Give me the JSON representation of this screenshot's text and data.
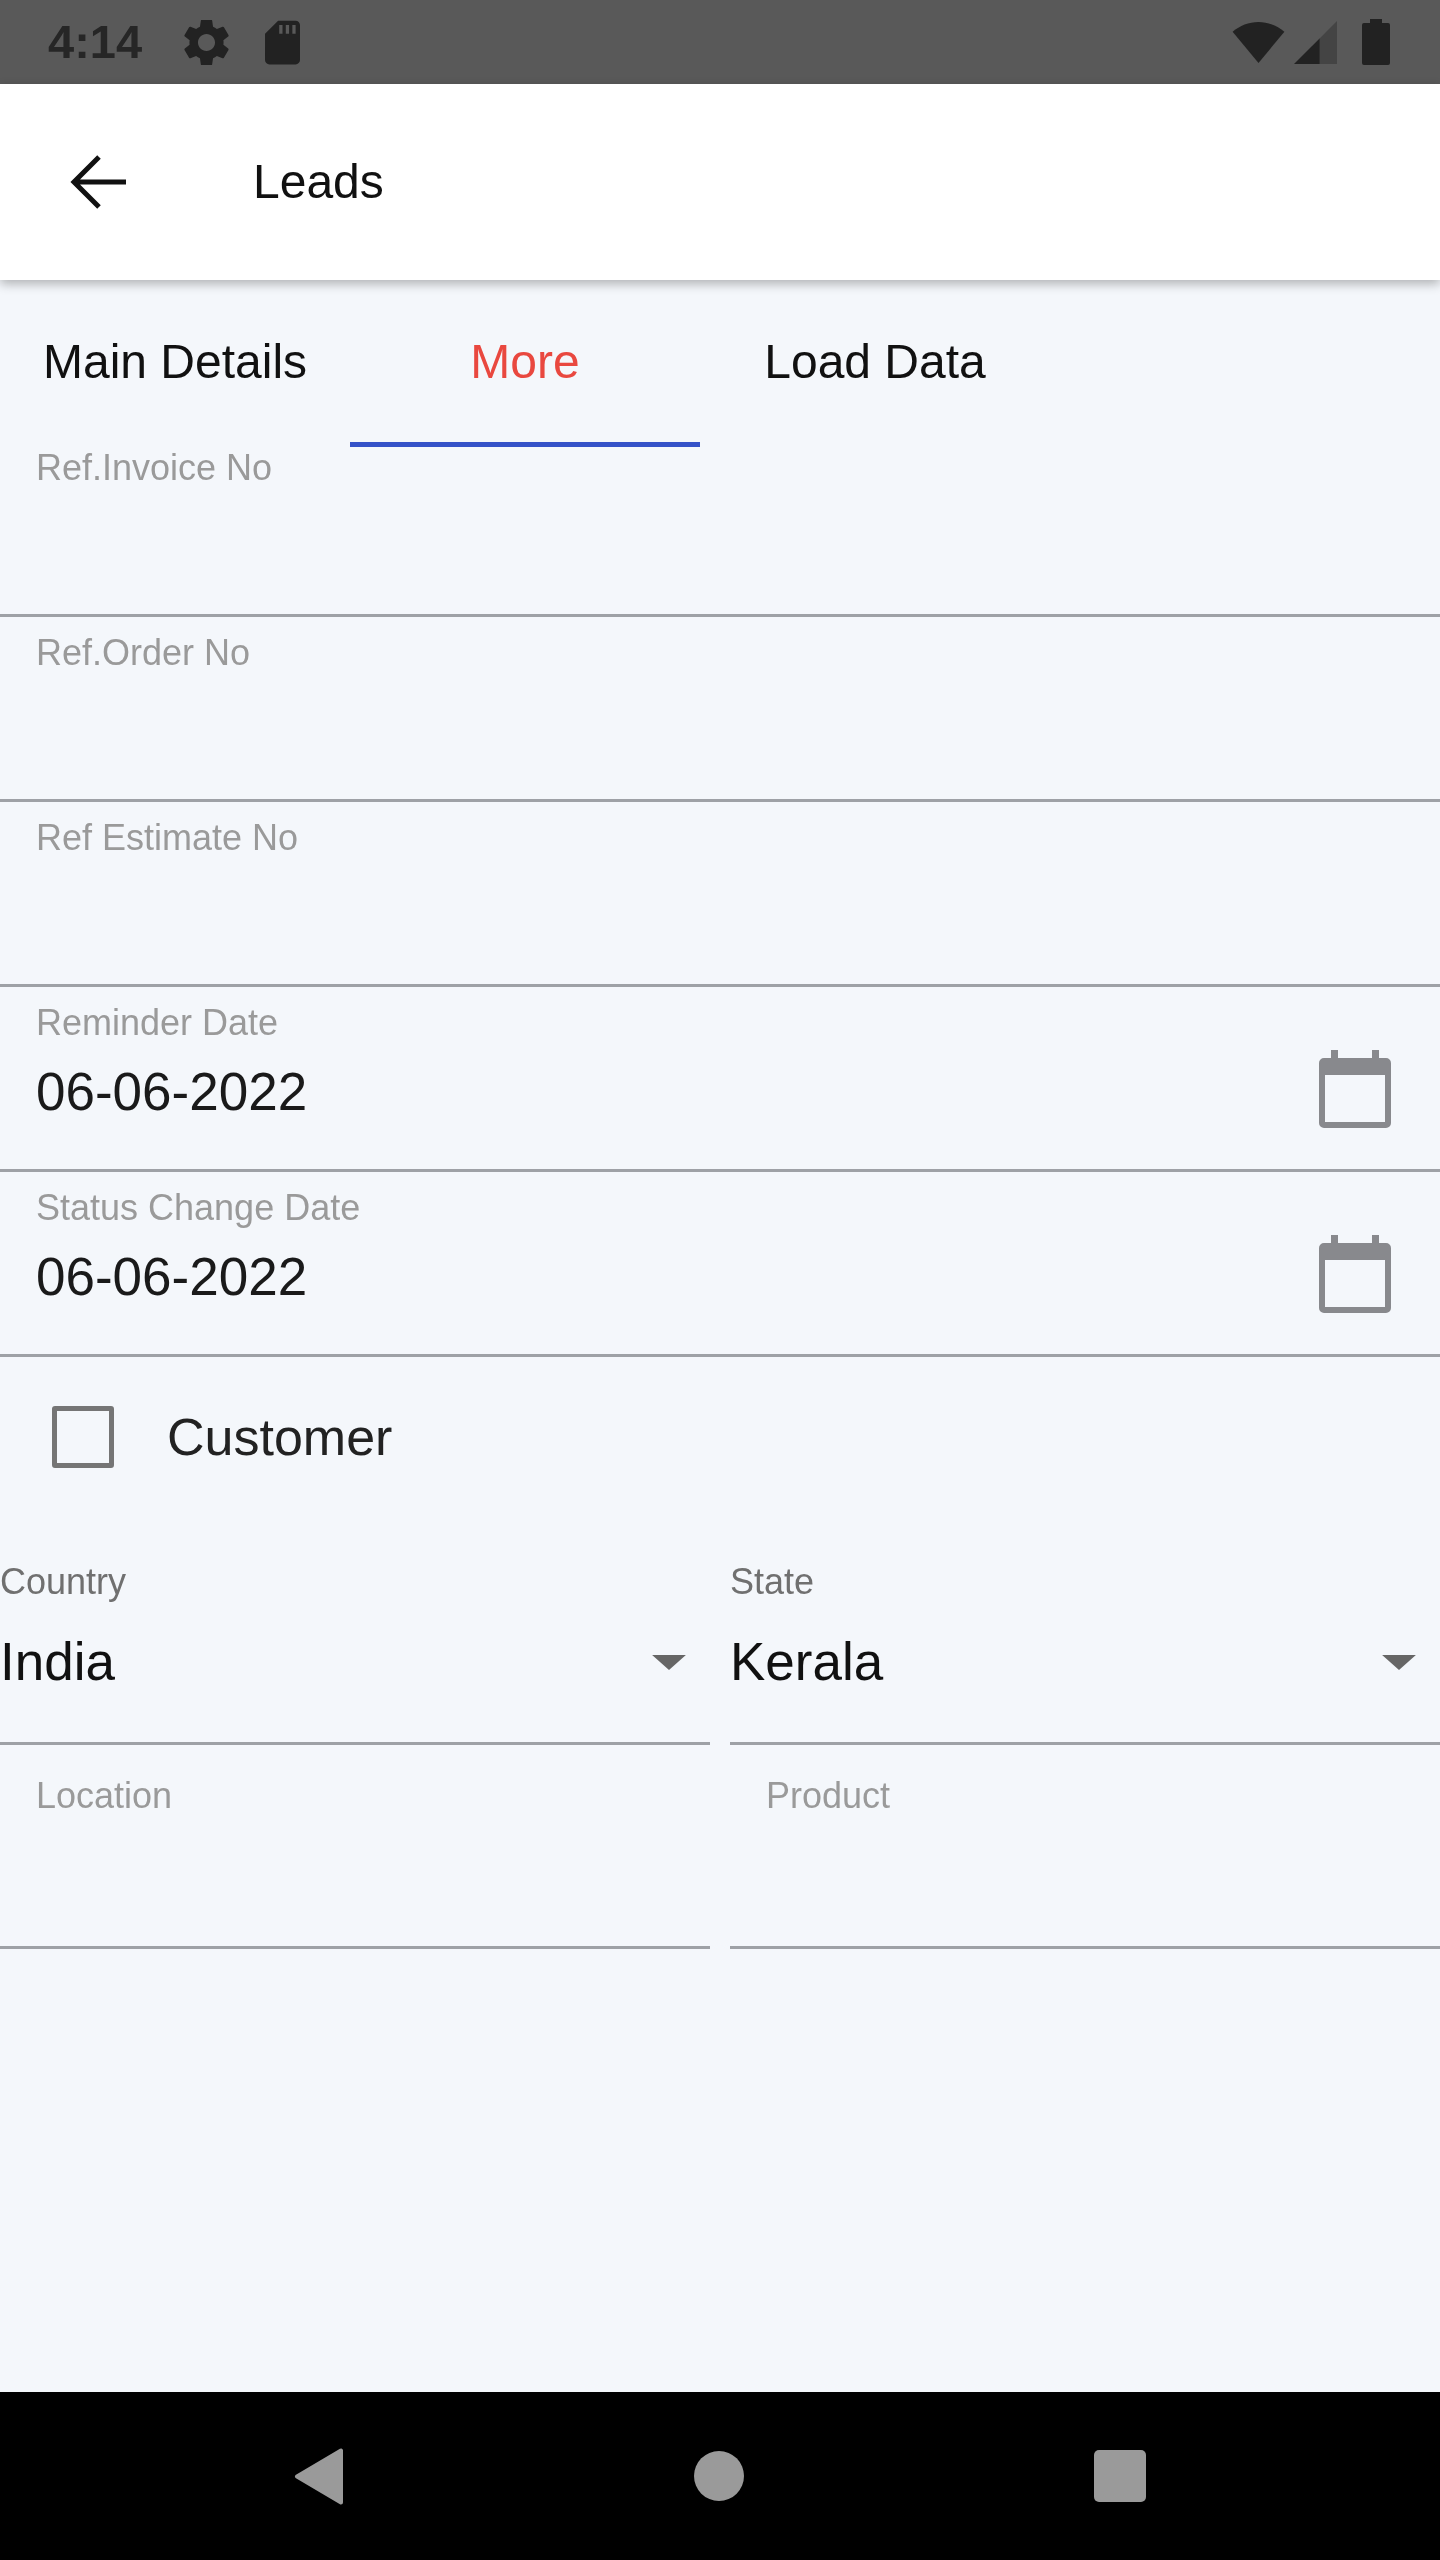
{
  "status_bar": {
    "time": "4:14"
  },
  "app_bar": {
    "title": "Leads"
  },
  "tabs": [
    {
      "label": "Main Details",
      "selected": false
    },
    {
      "label": "More",
      "selected": true
    },
    {
      "label": "Load Data",
      "selected": false
    }
  ],
  "fields": [
    {
      "kind": "text",
      "label": "Ref.Invoice No"
    },
    {
      "kind": "text",
      "label": "Ref.Order No"
    },
    {
      "kind": "text",
      "label": "Ref Estimate No"
    },
    {
      "kind": "date",
      "label": "Reminder Date",
      "value": "06-06-2022"
    },
    {
      "kind": "date",
      "label": "Status Change Date",
      "value": "06-06-2022"
    }
  ],
  "checkbox": {
    "label": "Customer",
    "checked": false
  },
  "dropdowns": [
    {
      "label": "Country",
      "value": "India"
    },
    {
      "label": "State",
      "value": "Kerala"
    }
  ],
  "bottom_fields": [
    {
      "label": "Location"
    },
    {
      "label": "Product"
    }
  ]
}
